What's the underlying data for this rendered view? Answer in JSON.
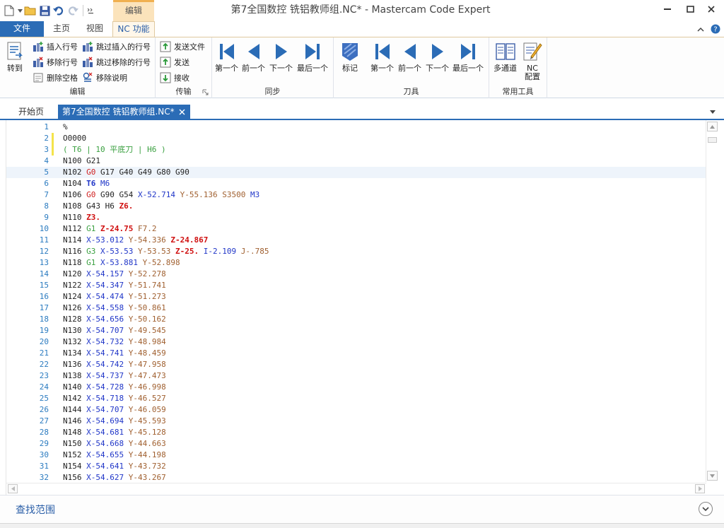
{
  "window": {
    "title": "第7全国数控 铣铝教师组.NC* - Mastercam Code Expert",
    "context_tab": "编辑"
  },
  "ribbon_tabs": {
    "file": "文件",
    "home": "主页",
    "view": "视图",
    "nc": "NC 功能"
  },
  "ribbon": {
    "edit_group": {
      "title": "编辑",
      "goto": "转到",
      "insert_line_numbers": "插入行号",
      "remove_line_numbers": "移除行号",
      "remove_spaces": "删除空格",
      "skip_insert_line_numbers": "跳过插入的行号",
      "skip_remove_line_numbers": "跳过移除的行号",
      "remove_comments": "移除说明"
    },
    "transfer_group": {
      "title": "传输",
      "send_file": "发送文件",
      "send": "发送",
      "receive": "接收"
    },
    "sync_group": {
      "title": "同步",
      "first": "第一个",
      "previous": "前一个",
      "next": "下一个",
      "last": "最后一个"
    },
    "mark_label": "标记",
    "tool_group": {
      "title": "刀具",
      "first": "第一个",
      "previous": "前一个",
      "next": "下一个",
      "last": "最后一个"
    },
    "common_group": {
      "title": "常用工具",
      "multichannel": "多通道",
      "nc_config_line1": "NC",
      "nc_config_line2": "配置"
    }
  },
  "doc_tabs": {
    "start": "开始页",
    "file": "第7全国数控 铣铝教师组.NC*"
  },
  "editor": {
    "current_line": 5,
    "modified_lines": [
      2,
      3
    ],
    "lines": [
      {
        "n": "1",
        "tokens": [
          [
            "plain",
            "%"
          ]
        ]
      },
      {
        "n": "2",
        "tokens": [
          [
            "plain",
            "O0000"
          ]
        ]
      },
      {
        "n": "3",
        "tokens": [
          [
            "c",
            "( T6 | 10 平底刀 | H6 )"
          ]
        ]
      },
      {
        "n": "4",
        "tokens": [
          [
            "n",
            "N100 "
          ],
          [
            "g",
            "G21"
          ]
        ]
      },
      {
        "n": "5",
        "tokens": [
          [
            "n",
            "N102 "
          ],
          [
            "g0",
            "G0"
          ],
          [
            "g",
            " G17 G40 G49 G80 G90"
          ]
        ]
      },
      {
        "n": "6",
        "tokens": [
          [
            "n",
            "N104 "
          ],
          [
            "t",
            "T6"
          ],
          [
            "m",
            " M6"
          ]
        ]
      },
      {
        "n": "7",
        "tokens": [
          [
            "n",
            "N106 "
          ],
          [
            "g0",
            "G0"
          ],
          [
            "g",
            " G90 G54 "
          ],
          [
            "x",
            "X-52.714"
          ],
          [
            "y",
            " Y-55.136"
          ],
          [
            "s",
            " S3500"
          ],
          [
            "m",
            " M3"
          ]
        ]
      },
      {
        "n": "8",
        "tokens": [
          [
            "n",
            "N108 "
          ],
          [
            "g",
            "G43 H6 "
          ],
          [
            "z",
            "Z6."
          ]
        ]
      },
      {
        "n": "9",
        "tokens": [
          [
            "n",
            "N110 "
          ],
          [
            "z",
            "Z3."
          ]
        ]
      },
      {
        "n": "10",
        "tokens": [
          [
            "n",
            "N112 "
          ],
          [
            "g1",
            "G1"
          ],
          [
            "z",
            " Z-24.75"
          ],
          [
            "f",
            " F7.2"
          ]
        ]
      },
      {
        "n": "11",
        "tokens": [
          [
            "n",
            "N114 "
          ],
          [
            "x",
            "X-53.012"
          ],
          [
            "y",
            " Y-54.336"
          ],
          [
            "z",
            " Z-24.867"
          ]
        ]
      },
      {
        "n": "12",
        "tokens": [
          [
            "n",
            "N116 "
          ],
          [
            "g1",
            "G3"
          ],
          [
            "x",
            " X-53.53"
          ],
          [
            "y",
            " Y-53.53"
          ],
          [
            "z",
            " Z-25."
          ],
          [
            "i",
            " I-2.109"
          ],
          [
            "j",
            " J-.785"
          ]
        ]
      },
      {
        "n": "13",
        "tokens": [
          [
            "n",
            "N118 "
          ],
          [
            "g1",
            "G1"
          ],
          [
            "x",
            " X-53.881"
          ],
          [
            "y",
            " Y-52.898"
          ]
        ]
      },
      {
        "n": "14",
        "tokens": [
          [
            "n",
            "N120 "
          ],
          [
            "x",
            "X-54.157"
          ],
          [
            "y",
            " Y-52.278"
          ]
        ]
      },
      {
        "n": "15",
        "tokens": [
          [
            "n",
            "N122 "
          ],
          [
            "x",
            "X-54.347"
          ],
          [
            "y",
            " Y-51.741"
          ]
        ]
      },
      {
        "n": "16",
        "tokens": [
          [
            "n",
            "N124 "
          ],
          [
            "x",
            "X-54.474"
          ],
          [
            "y",
            " Y-51.273"
          ]
        ]
      },
      {
        "n": "17",
        "tokens": [
          [
            "n",
            "N126 "
          ],
          [
            "x",
            "X-54.558"
          ],
          [
            "y",
            " Y-50.861"
          ]
        ]
      },
      {
        "n": "18",
        "tokens": [
          [
            "n",
            "N128 "
          ],
          [
            "x",
            "X-54.656"
          ],
          [
            "y",
            " Y-50.162"
          ]
        ]
      },
      {
        "n": "19",
        "tokens": [
          [
            "n",
            "N130 "
          ],
          [
            "x",
            "X-54.707"
          ],
          [
            "y",
            " Y-49.545"
          ]
        ]
      },
      {
        "n": "20",
        "tokens": [
          [
            "n",
            "N132 "
          ],
          [
            "x",
            "X-54.732"
          ],
          [
            "y",
            " Y-48.984"
          ]
        ]
      },
      {
        "n": "21",
        "tokens": [
          [
            "n",
            "N134 "
          ],
          [
            "x",
            "X-54.741"
          ],
          [
            "y",
            " Y-48.459"
          ]
        ]
      },
      {
        "n": "22",
        "tokens": [
          [
            "n",
            "N136 "
          ],
          [
            "x",
            "X-54.742"
          ],
          [
            "y",
            " Y-47.958"
          ]
        ]
      },
      {
        "n": "23",
        "tokens": [
          [
            "n",
            "N138 "
          ],
          [
            "x",
            "X-54.737"
          ],
          [
            "y",
            " Y-47.473"
          ]
        ]
      },
      {
        "n": "24",
        "tokens": [
          [
            "n",
            "N140 "
          ],
          [
            "x",
            "X-54.728"
          ],
          [
            "y",
            " Y-46.998"
          ]
        ]
      },
      {
        "n": "25",
        "tokens": [
          [
            "n",
            "N142 "
          ],
          [
            "x",
            "X-54.718"
          ],
          [
            "y",
            " Y-46.527"
          ]
        ]
      },
      {
        "n": "26",
        "tokens": [
          [
            "n",
            "N144 "
          ],
          [
            "x",
            "X-54.707"
          ],
          [
            "y",
            " Y-46.059"
          ]
        ]
      },
      {
        "n": "27",
        "tokens": [
          [
            "n",
            "N146 "
          ],
          [
            "x",
            "X-54.694"
          ],
          [
            "y",
            " Y-45.593"
          ]
        ]
      },
      {
        "n": "28",
        "tokens": [
          [
            "n",
            "N148 "
          ],
          [
            "x",
            "X-54.681"
          ],
          [
            "y",
            " Y-45.128"
          ]
        ]
      },
      {
        "n": "29",
        "tokens": [
          [
            "n",
            "N150 "
          ],
          [
            "x",
            "X-54.668"
          ],
          [
            "y",
            " Y-44.663"
          ]
        ]
      },
      {
        "n": "30",
        "tokens": [
          [
            "n",
            "N152 "
          ],
          [
            "x",
            "X-54.655"
          ],
          [
            "y",
            " Y-44.198"
          ]
        ]
      },
      {
        "n": "31",
        "tokens": [
          [
            "n",
            "N154 "
          ],
          [
            "x",
            "X-54.641"
          ],
          [
            "y",
            " Y-43.732"
          ]
        ]
      },
      {
        "n": "32",
        "tokens": [
          [
            "n",
            "N156 "
          ],
          [
            "x",
            "X-54.627"
          ],
          [
            "y",
            " Y-43.267"
          ]
        ]
      }
    ]
  },
  "find": {
    "label": "查找范围"
  },
  "colors": {
    "accent": "#2b6cb6",
    "context_tab": "#fbe3bb",
    "line_number": "#2b7bc0",
    "modified_marker": "#f4e34a"
  }
}
